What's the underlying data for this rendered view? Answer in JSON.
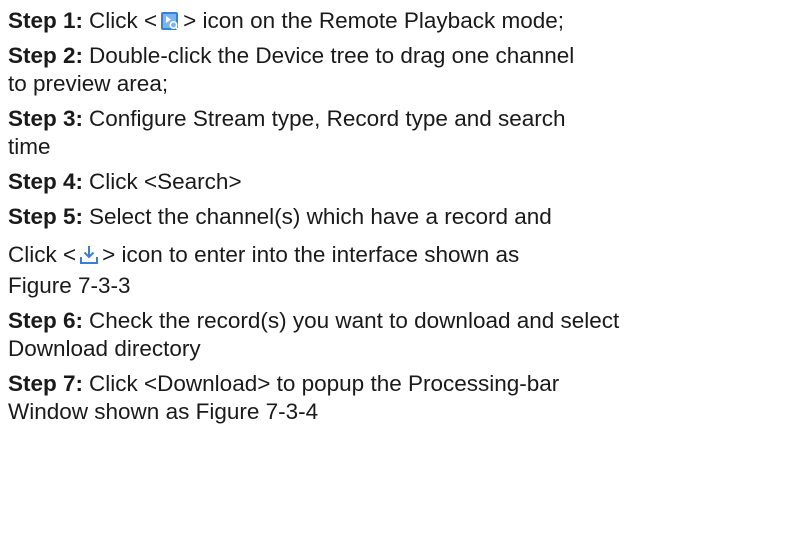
{
  "steps": [
    {
      "label": "Step 1:",
      "text_before": "Click <",
      "icon": "playback-file-icon",
      "text_after": "> icon on the Remote Playback mode;"
    },
    {
      "label": "Step 2:",
      "line1": "Double-click the Device tree to drag one channel",
      "line2": "to preview area;"
    },
    {
      "label": "Step 3:",
      "line1": "Configure Stream type, Record type and search",
      "line2": "time"
    },
    {
      "label": "Step 4:",
      "line1": "Click <Search>"
    },
    {
      "label": "Step 5:",
      "line1": "Select the channel(s) which have a record and",
      "line2_before": "Click <",
      "icon": "download-icon",
      "line2_after": "> icon to enter into the interface shown as",
      "line3": "Figure 7-3-3"
    },
    {
      "label": "Step 6:",
      "line1": "Check the record(s) you want to download and select",
      "line2": "Download directory"
    },
    {
      "label": "Step 7:",
      "line1": "Click <Download> to popup the Processing-bar",
      "line2": "Window shown as Figure 7-3-4"
    }
  ],
  "colors": {
    "text": "#1a1a1a",
    "icon_blue": "#3a7fd5",
    "icon_light": "#7ab6ee"
  }
}
